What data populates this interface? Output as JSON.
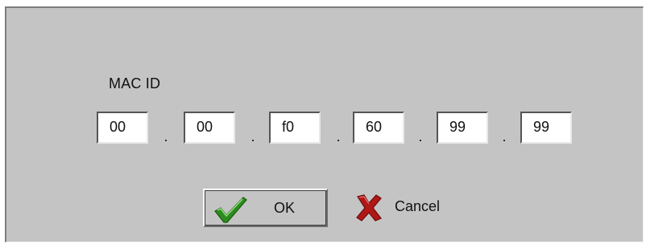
{
  "dialog": {
    "mac_label": "MAC ID",
    "octets": [
      "00",
      "00",
      "f0",
      "60",
      "99",
      "99"
    ],
    "separator": ".",
    "ok_label": "OK",
    "cancel_label": "Cancel"
  },
  "colors": {
    "background": "#c4c4c4",
    "field_background": "#ffffff",
    "ok_icon": "#2e8b1f",
    "cancel_icon": "#b01818"
  },
  "icons": {
    "ok": "checkmark-icon",
    "cancel": "x-icon"
  }
}
